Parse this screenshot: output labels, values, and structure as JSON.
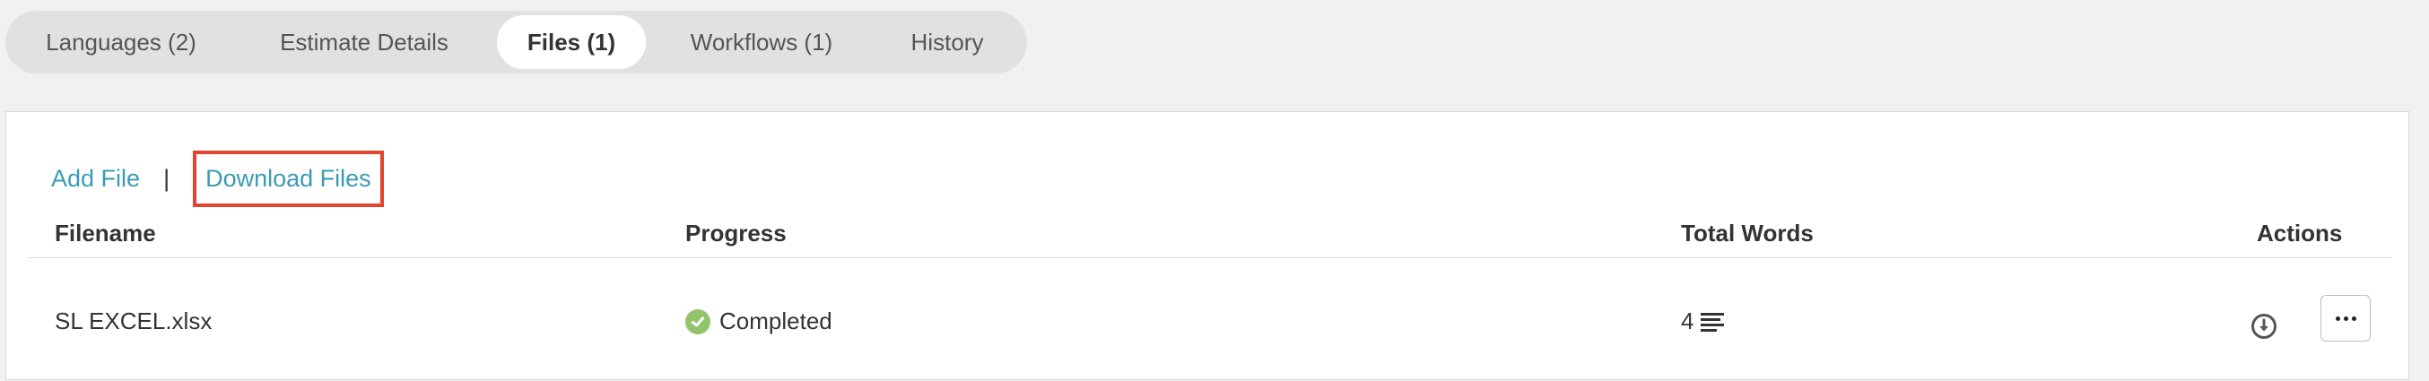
{
  "tabs": [
    {
      "label": "Languages (2)",
      "active": false
    },
    {
      "label": "Estimate Details",
      "active": false
    },
    {
      "label": "Files (1)",
      "active": true
    },
    {
      "label": "Workflows (1)",
      "active": false
    },
    {
      "label": "History",
      "active": false
    }
  ],
  "file_actions": {
    "add_label": "Add File",
    "separator": "|",
    "download_label": "Download Files"
  },
  "table": {
    "headers": {
      "filename": "Filename",
      "progress": "Progress",
      "total_words": "Total Words",
      "actions": "Actions"
    },
    "rows": [
      {
        "filename": "SL EXCEL.xlsx",
        "progress": "Completed",
        "total_words": "4",
        "actions": [
          "download-circle-icon",
          "more-options-icon"
        ]
      }
    ]
  },
  "colors": {
    "link": "#3a9bb5",
    "highlight_box": "#e0452f",
    "completed": "#93c36b"
  }
}
